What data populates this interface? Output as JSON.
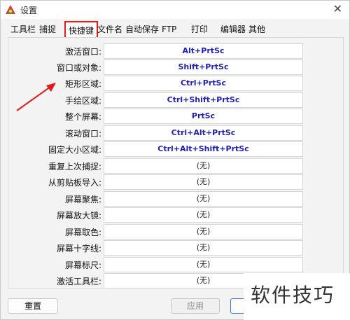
{
  "window": {
    "title": "设置",
    "close_glyph": "✕"
  },
  "tabs": [
    {
      "label": "工具栏"
    },
    {
      "label": "捕捉"
    },
    {
      "label": "快捷键"
    },
    {
      "label": "文件名"
    },
    {
      "label": "自动保存"
    },
    {
      "label": "FTP"
    },
    {
      "label": "打印"
    },
    {
      "label": "编辑器"
    },
    {
      "label": "其他"
    }
  ],
  "shortcuts": [
    {
      "label": "激活窗口:",
      "value": "Alt+PrtSc"
    },
    {
      "label": "窗口或对象:",
      "value": "Shift+PrtSc"
    },
    {
      "label": "矩形区域:",
      "value": "Ctrl+PrtSc"
    },
    {
      "label": "手绘区域:",
      "value": "Ctrl+Shift+PrtSc"
    },
    {
      "label": "整个屏幕:",
      "value": "PrtSc"
    },
    {
      "label": "滚动窗口:",
      "value": "Ctrl+Alt+PrtSc"
    },
    {
      "label": "固定大小区域:",
      "value": "Ctrl+Alt+Shift+PrtSc"
    },
    {
      "label": "重复上次捕捉:",
      "value": "(无)"
    },
    {
      "label": "从剪贴板导入:",
      "value": "(无)"
    },
    {
      "label": "屏幕聚焦:",
      "value": "(无)"
    },
    {
      "label": "屏幕放大镜:",
      "value": "(无)"
    },
    {
      "label": "屏幕取色:",
      "value": "(无)"
    },
    {
      "label": "屏幕十字线:",
      "value": "(无)"
    },
    {
      "label": "屏幕标尺:",
      "value": "(无)"
    },
    {
      "label": "激活工具栏:",
      "value": "(无)"
    }
  ],
  "buttons": {
    "reset": "重置",
    "apply": "应用",
    "ok": ""
  },
  "watermark": "软件技巧",
  "colors": {
    "accent_red": "#e01b1b",
    "shortcut_text": "#1f1fb5"
  }
}
